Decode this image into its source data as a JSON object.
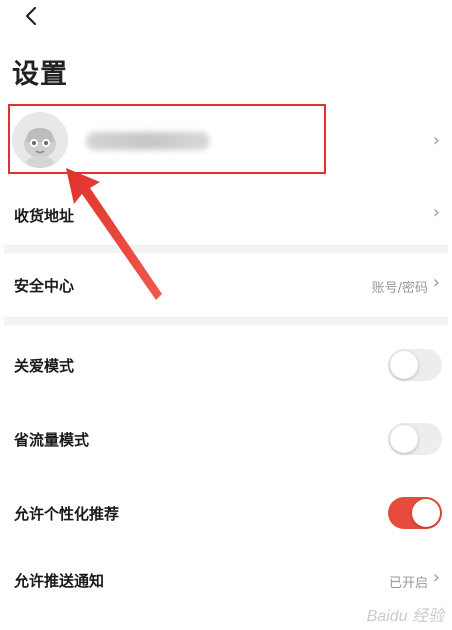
{
  "header": {
    "back_icon": "chevron-left-icon",
    "title": "设置"
  },
  "profile": {
    "avatar_icon": "avatar",
    "chevron": "›"
  },
  "menu": {
    "address": {
      "label": "收货地址",
      "chevron": "›"
    },
    "security": {
      "label": "安全中心",
      "value": "账号/密码",
      "chevron": "›"
    },
    "care_mode": {
      "label": "关爱模式",
      "enabled": false
    },
    "data_saver": {
      "label": "省流量模式",
      "enabled": false
    },
    "personalized": {
      "label": "允许个性化推荐",
      "enabled": true
    },
    "push": {
      "label": "允许推送通知",
      "value": "已开启",
      "chevron": "›"
    }
  },
  "colors": {
    "highlight": "#e0322d",
    "toggle_on": "#e64b3b",
    "toggle_off": "#ededed"
  }
}
